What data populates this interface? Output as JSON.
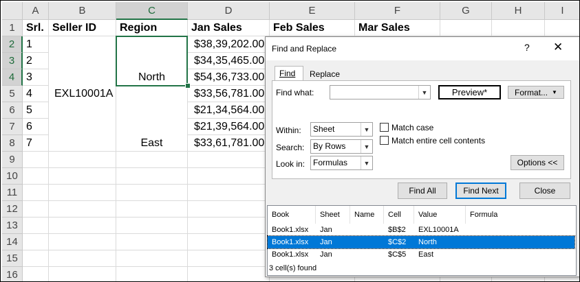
{
  "sheet": {
    "columns": [
      "A",
      "B",
      "C",
      "D",
      "E",
      "F",
      "G",
      "H",
      "I"
    ],
    "rows": [
      "1",
      "2",
      "3",
      "4",
      "5",
      "6",
      "7",
      "8",
      "9",
      "10",
      "11",
      "12",
      "13",
      "14",
      "15",
      "16"
    ],
    "headers": {
      "srl": "Srl.",
      "seller": "Seller ID",
      "region": "Region",
      "jan": "Jan Sales",
      "feb": "Feb Sales",
      "mar": "Mar Sales"
    },
    "srl_values": [
      "1",
      "2",
      "3",
      "4",
      "5",
      "6",
      "7"
    ],
    "seller_id": "EXL10001A",
    "regions": {
      "north": "North",
      "east": "East"
    },
    "jan_values": [
      "$38,39,202.00",
      "$34,35,465.00",
      "$54,36,733.00",
      "$33,56,781.00",
      "$21,34,564.00",
      "$21,39,564.00",
      "$33,61,781.00"
    ]
  },
  "dialog": {
    "title": "Find and Replace",
    "help": "?",
    "close": "✕",
    "tabs": {
      "find": "Find",
      "replace": "Replace"
    },
    "find_what_label": "Find what:",
    "find_value": "",
    "preview_label": "Preview*",
    "format_label": "Format...",
    "within_label": "Within:",
    "within_value": "Sheet",
    "search_label": "Search:",
    "search_value": "By Rows",
    "lookin_label": "Look in:",
    "lookin_value": "Formulas",
    "match_case_label": "Match case",
    "match_entire_label": "Match entire cell contents",
    "options_label": "Options <<",
    "find_all_label": "Find All",
    "find_next_label": "Find Next",
    "close_label": "Close",
    "results": {
      "columns": [
        "Book",
        "Sheet",
        "Name",
        "Cell",
        "Value",
        "Formula"
      ],
      "rows": [
        {
          "book": "Book1.xlsx",
          "sheet": "Jan",
          "name": "",
          "cell": "$B$2",
          "value": "EXL10001A",
          "formula": ""
        },
        {
          "book": "Book1.xlsx",
          "sheet": "Jan",
          "name": "",
          "cell": "$C$2",
          "value": "North",
          "formula": ""
        },
        {
          "book": "Book1.xlsx",
          "sheet": "Jan",
          "name": "",
          "cell": "$C$5",
          "value": "East",
          "formula": ""
        }
      ],
      "selected_row": 1,
      "status": "3 cell(s) found"
    }
  },
  "colors": {
    "excel_green": "#217346",
    "selection_blue": "#0078d7"
  }
}
